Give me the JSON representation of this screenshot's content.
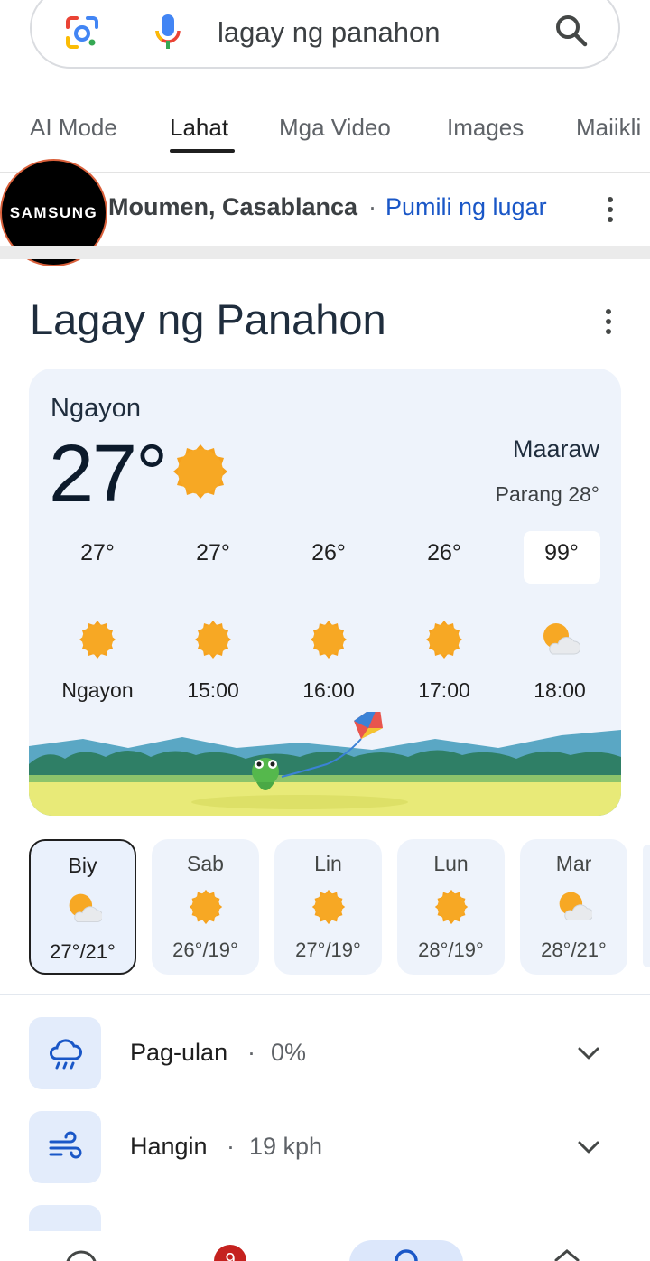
{
  "search": {
    "query": "lagay ng panahon"
  },
  "tabs": [
    {
      "label": "AI Mode"
    },
    {
      "label": "Lahat"
    },
    {
      "label": "Mga Video"
    },
    {
      "label": "Images"
    },
    {
      "label": "Maiikli"
    }
  ],
  "location": {
    "avatar_text": "SAMSUNG",
    "name": "Moumen, Casablanca",
    "separator": "·",
    "link": "Pumili ng lugar"
  },
  "weather": {
    "title": "Lagay ng Panahon",
    "now_label": "Ngayon",
    "now_temp": "27°",
    "condition": "Maaraw",
    "feels_like": "Parang 28°",
    "hourly": [
      {
        "temp": "27°",
        "time": "Ngayon",
        "icon": "sun-icon"
      },
      {
        "temp": "27°",
        "time": "15:00",
        "icon": "sun-icon"
      },
      {
        "temp": "26°",
        "time": "16:00",
        "icon": "sun-icon"
      },
      {
        "temp": "26°",
        "time": "17:00",
        "icon": "sun-icon"
      },
      {
        "temp": "99°",
        "time": "18:00",
        "icon": "partly-cloudy-icon"
      }
    ],
    "daily": [
      {
        "day": "Biy",
        "temps": "27°/21°",
        "icon": "partly-cloudy-icon",
        "selected": true
      },
      {
        "day": "Sab",
        "temps": "26°/19°",
        "icon": "sun-icon"
      },
      {
        "day": "Lin",
        "temps": "27°/19°",
        "icon": "sun-icon"
      },
      {
        "day": "Lun",
        "temps": "28°/19°",
        "icon": "sun-icon"
      },
      {
        "day": "Mar",
        "temps": "28°/21°",
        "icon": "partly-cloudy-icon"
      }
    ],
    "details": [
      {
        "label": "Pag-ulan",
        "dot": "·",
        "value": "0%",
        "icon": "rain-cloud-icon"
      },
      {
        "label": "Hangin",
        "dot": "·",
        "value": "19 kph",
        "icon": "wind-icon"
      }
    ]
  },
  "bottom_nav": {
    "badge": "9"
  },
  "colors": {
    "accent": "#1a57c7",
    "sun": "#f6a21e",
    "card": "#eef3fb",
    "badge": "#c5221f"
  }
}
